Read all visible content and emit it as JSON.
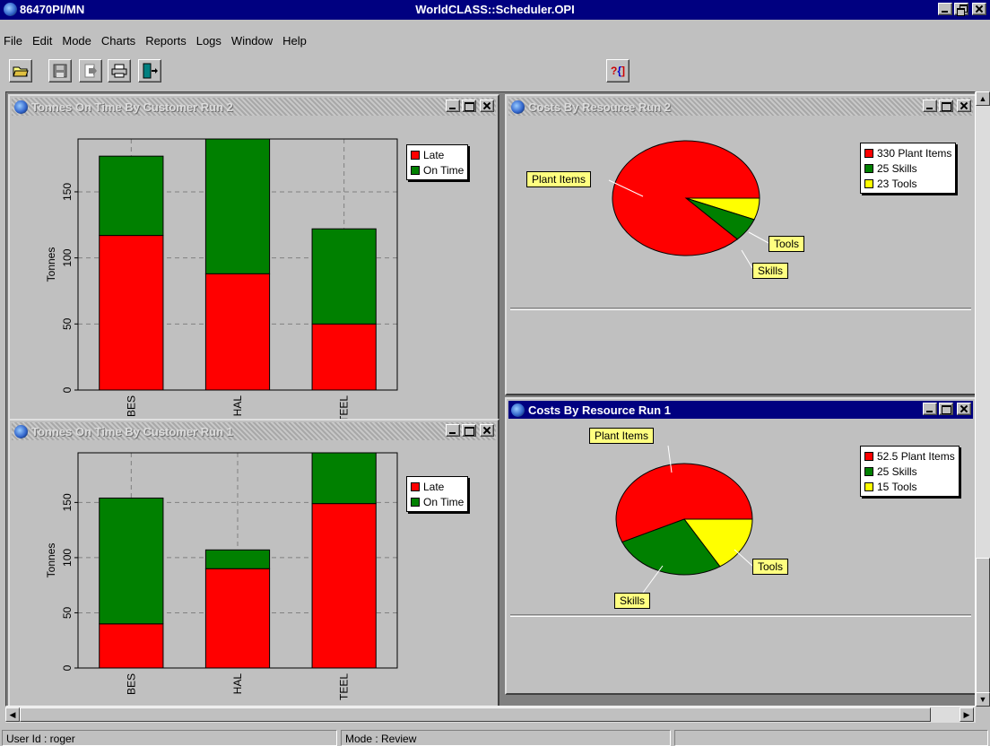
{
  "app": {
    "window_id": "86470PI/MN",
    "title": "WorldCLASS::Scheduler.OPI"
  },
  "menu": [
    "File",
    "Edit",
    "Mode",
    "Charts",
    "Reports",
    "Logs",
    "Window",
    "Help"
  ],
  "toolbar": {
    "icons": [
      "open-folder-icon",
      "save-icon",
      "export-icon",
      "print-icon",
      "exit-door-icon",
      "context-help-icon"
    ]
  },
  "windows": {
    "tonnes_run2": {
      "title": "Tonnes On Time By Customer Run 2"
    },
    "tonnes_run1": {
      "title": "Tonnes On Time By Customer Run 1"
    },
    "costs_run2": {
      "title": "Costs By Resource Run 2"
    },
    "costs_run1": {
      "title": "Costs By Resource Run 1"
    }
  },
  "bar_legend": {
    "late": "Late",
    "on_time": "On Time"
  },
  "pie_labels": {
    "plant": "Plant Items",
    "skills": "Skills",
    "tools": "Tools"
  },
  "colors": {
    "late": "#ff0000",
    "on_time": "#008000",
    "tools": "#ffff00",
    "titlebar": "#000080"
  },
  "status": {
    "user": "User Id : roger",
    "mode": "Mode : Review"
  },
  "chart_data": [
    {
      "id": "tonnes_run2",
      "type": "bar",
      "stacked": true,
      "title": "Tonnes On Time By Customer Run 2",
      "categories": [
        "BES",
        "HAL",
        "TEEL"
      ],
      "series": [
        {
          "name": "Late",
          "values": [
            117,
            88,
            50
          ]
        },
        {
          "name": "On Time",
          "values": [
            60,
            102,
            72
          ]
        }
      ],
      "ylabel": "Tonnes",
      "yticks": [
        0,
        50,
        100,
        150
      ],
      "ylim": [
        0,
        190
      ],
      "grid": true,
      "legend": "top-right"
    },
    {
      "id": "tonnes_run1",
      "type": "bar",
      "stacked": true,
      "title": "Tonnes On Time By Customer Run 1",
      "categories": [
        "BES",
        "HAL",
        "TEEL"
      ],
      "series": [
        {
          "name": "Late",
          "values": [
            40,
            90,
            149
          ]
        },
        {
          "name": "On Time",
          "values": [
            114,
            17,
            51
          ]
        }
      ],
      "ylabel": "Tonnes",
      "yticks": [
        0,
        50,
        100,
        150
      ],
      "ylim": [
        0,
        195
      ],
      "grid": true,
      "legend": "top-right"
    },
    {
      "id": "costs_run2",
      "type": "pie",
      "title": "Costs By Resource Run 2",
      "labels": [
        "Plant Items",
        "Skills",
        "Tools"
      ],
      "values": [
        330,
        25,
        23
      ],
      "legend_entries": [
        "330 Plant Items",
        "25 Skills",
        "23 Tools"
      ],
      "legend": "top-right"
    },
    {
      "id": "costs_run1",
      "type": "pie",
      "title": "Costs By Resource Run 1",
      "labels": [
        "Plant Items",
        "Skills",
        "Tools"
      ],
      "values": [
        52.5,
        25,
        15
      ],
      "legend_entries": [
        "52.5 Plant Items",
        "25 Skills",
        "15 Tools"
      ],
      "legend": "top-right"
    }
  ]
}
